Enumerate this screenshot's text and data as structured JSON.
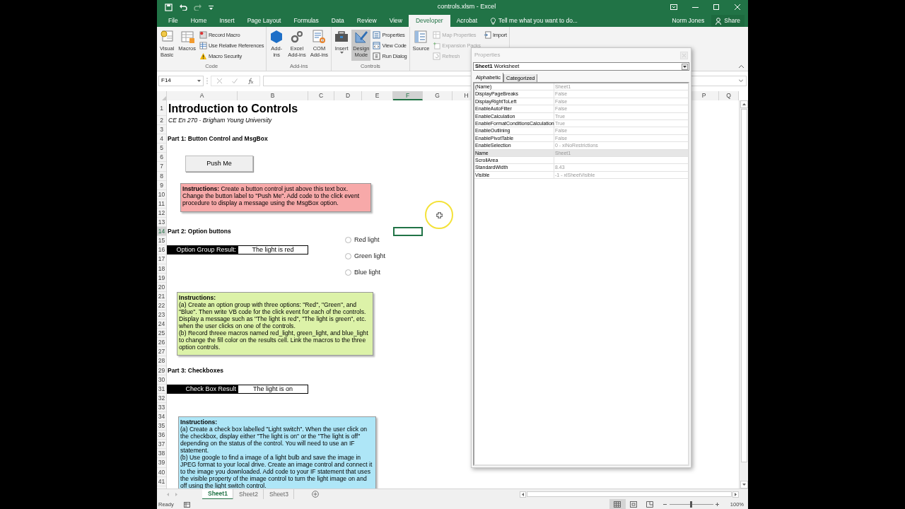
{
  "window": {
    "title": "controls.xlsm - Excel"
  },
  "ribbon_tabs": [
    {
      "label": "File",
      "selected": false
    },
    {
      "label": "Home",
      "selected": false
    },
    {
      "label": "Insert",
      "selected": false
    },
    {
      "label": "Page Layout",
      "selected": false
    },
    {
      "label": "Formulas",
      "selected": false
    },
    {
      "label": "Data",
      "selected": false
    },
    {
      "label": "Review",
      "selected": false
    },
    {
      "label": "View",
      "selected": false
    },
    {
      "label": "Developer",
      "selected": true
    },
    {
      "label": "Acrobat",
      "selected": false
    }
  ],
  "tell_me": "Tell me what you want to do...",
  "user_name": "Norm Jones",
  "share_button": "Share",
  "ribbon_groups": [
    {
      "label": "Code",
      "items": [
        {
          "kind": "large",
          "label": "Visual\nBasic"
        },
        {
          "kind": "large",
          "label": "Macros"
        },
        {
          "kind": "small",
          "label": "Record Macro"
        },
        {
          "kind": "small",
          "label": "Use Relative References"
        },
        {
          "kind": "small",
          "label": "Macro Security"
        }
      ]
    },
    {
      "label": "Add-ins",
      "items": [
        {
          "kind": "large",
          "label": "Add-\nins"
        },
        {
          "kind": "large",
          "label": "Excel\nAdd-ins"
        },
        {
          "kind": "large",
          "label": "COM\nAdd-ins"
        }
      ]
    },
    {
      "label": "Controls",
      "items": [
        {
          "kind": "large",
          "label": "Insert",
          "pressed": false
        },
        {
          "kind": "large",
          "label": "Design\nMode",
          "pressed": true
        },
        {
          "kind": "small",
          "label": "Properties",
          "pressed": false
        },
        {
          "kind": "small",
          "label": "View Code",
          "pressed": false
        },
        {
          "kind": "small",
          "label": "Run Dialog",
          "pressed": false
        }
      ]
    },
    {
      "items": [
        {
          "kind": "large",
          "label": "Source",
          "disabled": false
        },
        {
          "kind": "small",
          "label": "Map Properties",
          "disabled": true
        },
        {
          "kind": "small",
          "label": "Expansion Packs",
          "disabled": true
        },
        {
          "kind": "small",
          "label": "Refresh",
          "disabled": true
        },
        {
          "kind": "small",
          "label": "Import",
          "disabled": false
        }
      ]
    }
  ],
  "formula_bar": {
    "name_box": "F14"
  },
  "sheet": {
    "columns": [
      {
        "label": "A",
        "selected": false
      },
      {
        "label": "B",
        "selected": false
      },
      {
        "label": "C",
        "selected": false
      },
      {
        "label": "D",
        "selected": false
      },
      {
        "label": "E",
        "selected": false
      },
      {
        "label": "F",
        "selected": true
      },
      {
        "label": "G",
        "selected": false
      },
      {
        "label": "H",
        "selected": false
      },
      {
        "label": "P",
        "selected": false
      },
      {
        "label": "Q",
        "selected": false
      }
    ],
    "rows": [
      {
        "label": "1",
        "selected": false,
        "cells": [
          {
            "kind": "title",
            "text": "Introduction to Controls"
          }
        ]
      },
      {
        "label": "2",
        "selected": false,
        "cells": [
          {
            "kind": "subtitle",
            "text": "CE En 270 - Brigham Young University"
          }
        ]
      },
      {
        "label": "3",
        "selected": false
      },
      {
        "label": "4",
        "selected": false,
        "cells": [
          {
            "kind": "heading",
            "text": "Part 1: Button Control and MsgBox"
          }
        ]
      },
      {
        "label": "5",
        "selected": false
      },
      {
        "label": "6",
        "selected": false
      },
      {
        "label": "7",
        "selected": false
      },
      {
        "label": "8",
        "selected": false
      },
      {
        "label": "9",
        "selected": false
      },
      {
        "label": "10",
        "selected": false
      },
      {
        "label": "11",
        "selected": false
      },
      {
        "label": "12",
        "selected": false
      },
      {
        "label": "13",
        "selected": false
      },
      {
        "label": "14",
        "selected": true,
        "cells": [
          {
            "kind": "heading",
            "text": "Part 2: Option buttons"
          }
        ]
      },
      {
        "label": "15",
        "selected": false
      },
      {
        "label": "16",
        "selected": false,
        "cells": [
          {
            "kind": "label",
            "text": "Option Group Result:"
          },
          {
            "kind": "result",
            "text": "The light is red"
          }
        ]
      },
      {
        "label": "17",
        "selected": false
      },
      {
        "label": "18",
        "selected": false
      },
      {
        "label": "19",
        "selected": false
      },
      {
        "label": "20",
        "selected": false
      },
      {
        "label": "21",
        "selected": false
      },
      {
        "label": "22",
        "selected": false
      },
      {
        "label": "23",
        "selected": false
      },
      {
        "label": "24",
        "selected": false
      },
      {
        "label": "25",
        "selected": false
      },
      {
        "label": "26",
        "selected": false
      },
      {
        "label": "27",
        "selected": false
      },
      {
        "label": "28",
        "selected": false
      },
      {
        "label": "29",
        "selected": false,
        "cells": [
          {
            "kind": "heading",
            "text": "Part 3: Checkboxes"
          }
        ]
      },
      {
        "label": "30",
        "selected": false
      },
      {
        "label": "31",
        "selected": false,
        "cells": [
          {
            "kind": "label",
            "text": "Check Box Result"
          },
          {
            "kind": "result",
            "text": "The light is on"
          }
        ]
      },
      {
        "label": "32",
        "selected": false
      },
      {
        "label": "33",
        "selected": false
      },
      {
        "label": "34",
        "selected": false
      },
      {
        "label": "35",
        "selected": false
      },
      {
        "label": "36",
        "selected": false
      },
      {
        "label": "37",
        "selected": false
      },
      {
        "label": "38",
        "selected": false
      },
      {
        "label": "39",
        "selected": false
      },
      {
        "label": "40",
        "selected": false
      },
      {
        "label": "41",
        "selected": false
      }
    ],
    "shapes": [
      {
        "kind": "button",
        "text": "Push Me"
      },
      {
        "kind": "note",
        "color": "#f7a9a9",
        "text": "**Instructions:**  Create a button control just above this text box.\nChange the button label to \"Push Me\".  Add code to the click event\nprocedure to display a message using the MsgBox option."
      },
      {
        "kind": "option",
        "text": "Red light",
        "selected": false
      },
      {
        "kind": "option",
        "text": "Green light",
        "selected": false
      },
      {
        "kind": "option",
        "text": "Blue light",
        "selected": false
      },
      {
        "kind": "note",
        "color": "#dcf2a8",
        "text": "**Instructions:**\n(a) Create an option group with three options: \"Red\", \"Green\", and\n\"Blue\".   Then write VB code for the click event for each of the controls.\nDisplay a message such as \"The light is red\", \"The light is green\", etc.\nwhen the user clicks on one of the controls.\n(b) Record threee macros named red_light, green_light, and blue_light\nto change the fill color on the results cell. Link the macros to the three\noption controls."
      },
      {
        "kind": "note",
        "color": "#aee6f7",
        "text": "**Instructions:**\n(a) Create a check box labelled \"Light switch\".  When the user click on\nthe checkbox, display either \"The light is on\" or the \"The light is off\"\ndepending on the status of the control. You will need to use an IF\nstatement.\n(b) Use google to find a image of a light bulb and save the image in\nJPEG format to your local drive. Create an image control and connect it\nto the image you downloaded. Add code to your IF statement that uses\nthe visible property of the image control to turn the light image on and\noff using the light switch control."
      }
    ]
  },
  "properties_window": {
    "title": "Properties",
    "object": "**Sheet1** Worksheet",
    "tabs": [
      {
        "label": "Alphabetic",
        "selected": true
      },
      {
        "label": "Categorized",
        "selected": false
      }
    ],
    "properties": [
      {
        "name": "(Name)",
        "value": "Sheet1",
        "selected": false
      },
      {
        "name": "DisplayPageBreaks",
        "value": "False",
        "selected": false
      },
      {
        "name": "DisplayRightToLeft",
        "value": "False",
        "selected": false
      },
      {
        "name": "EnableAutoFilter",
        "value": "False",
        "selected": false
      },
      {
        "name": "EnableCalculation",
        "value": "True",
        "selected": false
      },
      {
        "name": "EnableFormatConditionsCalculation",
        "value": "True",
        "selected": false
      },
      {
        "name": "EnableOutlining",
        "value": "False",
        "selected": false
      },
      {
        "name": "EnablePivotTable",
        "value": "False",
        "selected": false
      },
      {
        "name": "EnableSelection",
        "value": "0 - xlNoRestrictions",
        "selected": false
      },
      {
        "name": "Name",
        "value": "Sheet1",
        "selected": true
      },
      {
        "name": "ScrollArea",
        "selected": false
      },
      {
        "name": "StandardWidth",
        "value": "8.43",
        "selected": false
      },
      {
        "name": "Visible",
        "value": "-1 - xlSheetVisible",
        "selected": false
      }
    ]
  },
  "sheet_tabs": [
    {
      "label": "Sheet1",
      "selected": true
    },
    {
      "label": "Sheet2",
      "selected": false
    },
    {
      "label": "Sheet3",
      "selected": false
    }
  ],
  "status_bar": {
    "status": "Ready",
    "views": [
      {
        "kind": "normal",
        "selected": true
      },
      {
        "kind": "page_layout",
        "selected": false
      },
      {
        "kind": "page_break",
        "selected": false
      }
    ],
    "zoom": {
      "level": 0.5,
      "reading": "100%"
    }
  }
}
